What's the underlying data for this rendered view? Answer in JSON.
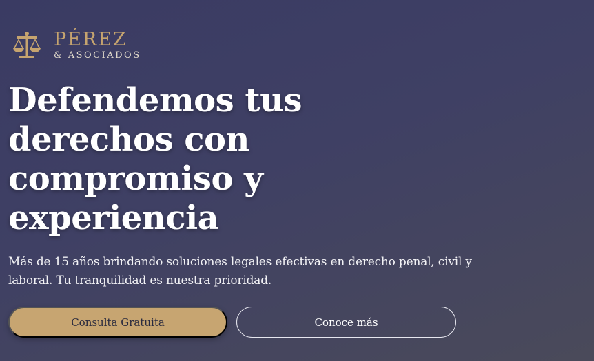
{
  "brand": {
    "name": "PÉREZ",
    "subname": "& ASOCIADOS",
    "accent_color": "#c6a46f",
    "icon": "scales-of-justice-icon"
  },
  "hero": {
    "title_lines": [
      "Defendemos tus",
      "derechos con",
      "compromiso y",
      "experiencia"
    ],
    "subtitle": "Más de 15 años brindando soluciones legales efectivas en derecho penal, civil y laboral. Tu tranquilidad es nuestra prioridad.",
    "primary_button": "Consulta Gratuita",
    "secondary_button": "Conoce más"
  }
}
